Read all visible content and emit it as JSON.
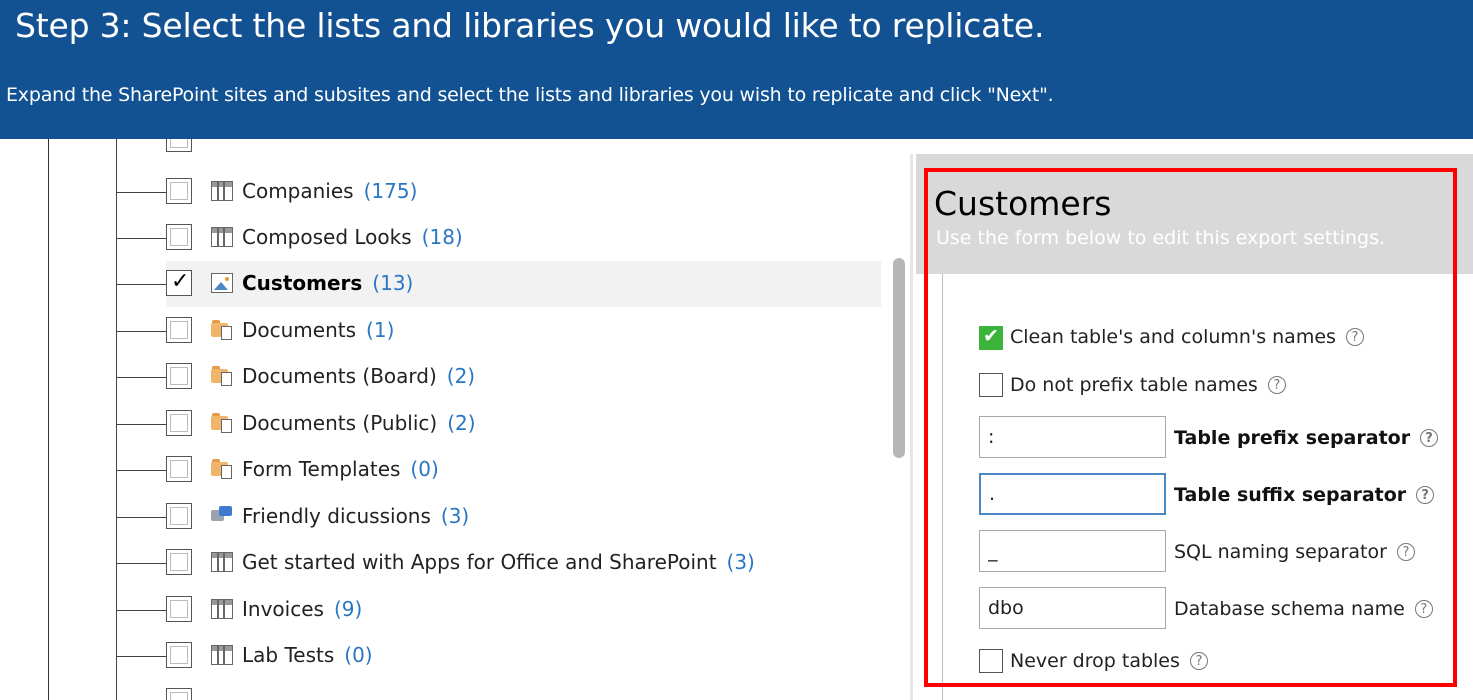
{
  "header": {
    "title": "Step 3: Select the lists and libraries you would like to replicate.",
    "subtitle": "Expand the SharePoint sites and subsites and select the lists and libraries you wish to replicate and click \"Next\"."
  },
  "tree": {
    "items": [
      {
        "name": "Companies",
        "count": "(175)",
        "icon": "table-icon",
        "checked": false
      },
      {
        "name": "Composed Looks",
        "count": "(18)",
        "icon": "table-icon",
        "checked": false
      },
      {
        "name": "Customers",
        "count": "(13)",
        "icon": "picture-library-icon",
        "checked": true,
        "selected": true
      },
      {
        "name": "Documents",
        "count": "(1)",
        "icon": "document-library-icon",
        "checked": false
      },
      {
        "name": "Documents (Board)",
        "count": "(2)",
        "icon": "document-library-icon",
        "checked": false
      },
      {
        "name": "Documents (Public)",
        "count": "(2)",
        "icon": "document-library-icon",
        "checked": false
      },
      {
        "name": "Form Templates",
        "count": "(0)",
        "icon": "document-library-icon",
        "checked": false
      },
      {
        "name": "Friendly dicussions",
        "count": "(3)",
        "icon": "discussion-icon",
        "checked": false
      },
      {
        "name": "Get started with Apps for Office and SharePoint",
        "count": "(3)",
        "icon": "table-icon",
        "checked": false
      },
      {
        "name": "Invoices",
        "count": "(9)",
        "icon": "table-icon",
        "checked": false
      },
      {
        "name": "Lab Tests",
        "count": "(0)",
        "icon": "table-icon",
        "checked": false
      }
    ]
  },
  "panel": {
    "title": "Customers",
    "subtitle": "Use the form below to edit this export settings.",
    "clean_names_label": "Clean table's and column's names",
    "clean_names_checked": true,
    "no_prefix_label": "Do not prefix table names",
    "no_prefix_checked": false,
    "prefix_sep_value": ":",
    "prefix_sep_label": "Table prefix separator",
    "suffix_sep_value": ".",
    "suffix_sep_label": "Table suffix separator",
    "sql_sep_value": "_",
    "sql_sep_label": "SQL naming separator",
    "schema_value": "dbo",
    "schema_label": "Database schema name",
    "never_drop_label": "Never drop tables",
    "never_drop_checked": false,
    "help_glyph": "?"
  },
  "colors": {
    "header_bg": "#125192",
    "highlight_border": "#ff0000",
    "count_text": "#2a76c6",
    "checkbox_green": "#3cb43c"
  }
}
